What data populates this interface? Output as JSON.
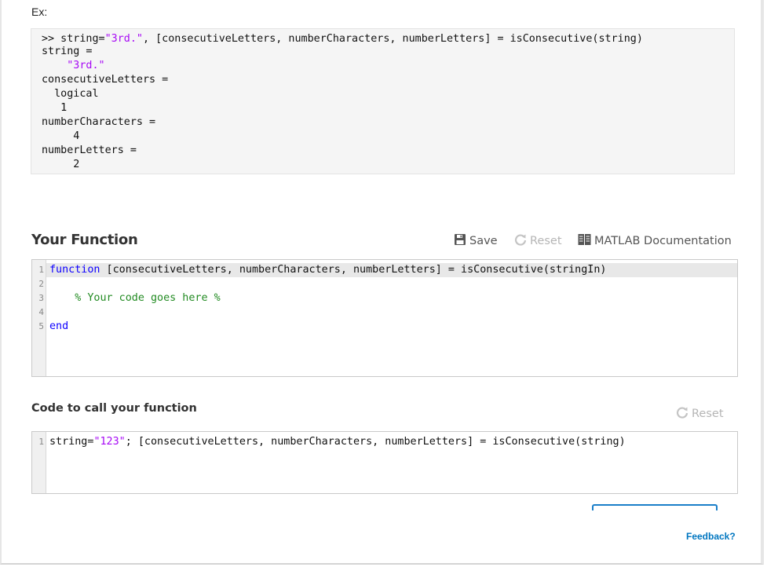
{
  "example": {
    "label": "Ex:",
    "lines": [
      {
        "parts": [
          ">> string=",
          {
            "s": "\"3rd.\""
          },
          ", [consecutiveLetters, numberCharacters, numberLetters] = isConsecutive(string)"
        ]
      },
      {
        "text": "string ="
      },
      {
        "str": "    \"3rd.\""
      },
      {
        "text": "consecutiveLetters ="
      },
      {
        "text": "  logical"
      },
      {
        "text": "   1"
      },
      {
        "text": "numberCharacters ="
      },
      {
        "text": "     4"
      },
      {
        "text": "numberLetters ="
      },
      {
        "text": "     2"
      }
    ],
    "line0_prefix": ">> string=",
    "line0_string": "\"3rd.\"",
    "line0_rest": ", [consecutiveLetters, numberCharacters, numberLetters] = isConsecutive(string)",
    "line1": "string =",
    "line2": "    \"3rd.\"",
    "line3": "consecutiveLetters =",
    "line4": "  logical",
    "line5": "   1",
    "line6": "numberCharacters =",
    "line7": "     4",
    "line8": "numberLetters =",
    "line9": "     2"
  },
  "your_function": {
    "title": "Your Function",
    "toolbar": {
      "save_label": "Save",
      "reset_label": "Reset",
      "docs_label": "MATLAB Documentation"
    },
    "line_numbers": [
      "1",
      "2",
      "3",
      "4",
      "5"
    ],
    "code": {
      "line1_keyword": "function",
      "line1_rest": " [consecutiveLetters, numberCharacters, numberLetters] = isConsecutive(stringIn)",
      "line3_comment": "    % Your code goes here %",
      "line5_keyword": "end"
    }
  },
  "call_function": {
    "title": "Code to call your function",
    "reset_label": "Reset",
    "line_numbers": [
      "1"
    ],
    "code": {
      "prefix": "string=",
      "string": "\"123\"",
      "rest": "; [consecutiveLetters, numberCharacters, numberLetters] = isConsecutive(string)"
    }
  },
  "footer": {
    "feedback_label": "Feedback?"
  },
  "colors": {
    "string": "#a709f5",
    "keyword": "#0e00ff",
    "comment": "#228b22",
    "link": "#0076c0",
    "button_border": "#1a7fc9"
  }
}
